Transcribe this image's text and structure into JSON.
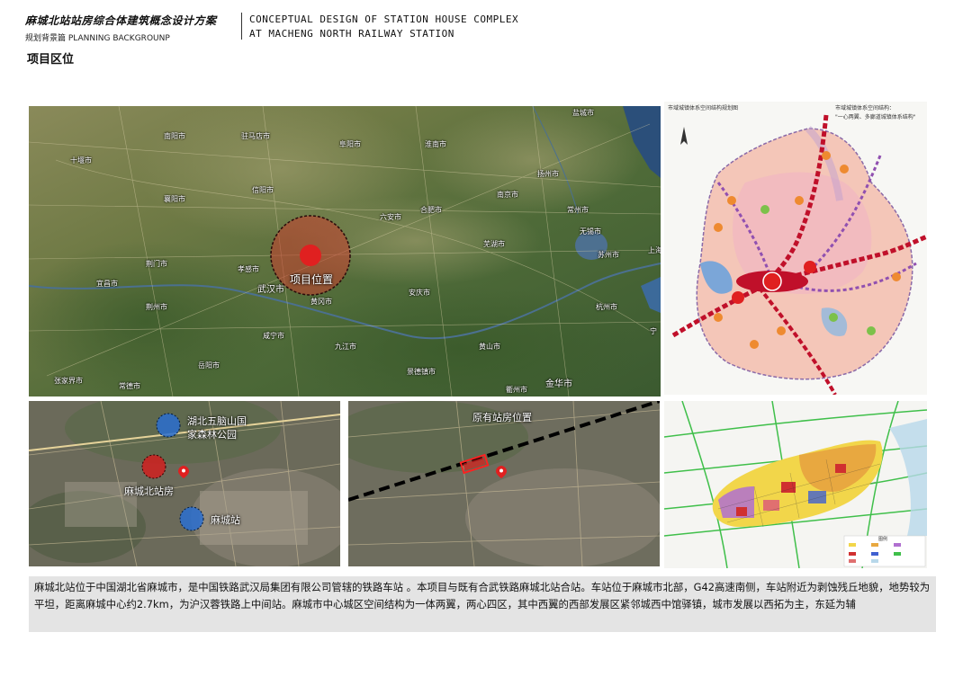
{
  "header": {
    "cn_title": "麻城北站站房综合体建筑概念设计方案",
    "subtitle": "规划背景篇  PLANNING BACKGROUNP",
    "en_title_line1": "CONCEPTUAL DESIGN OF STATION HOUSE COMPLEX",
    "en_title_line2": "AT MACHENG NORTH RAILWAY STATION"
  },
  "section_title": "项目区位",
  "main_map": {
    "project_label": "项目位置",
    "cities": [
      "盐城市",
      "南阳市",
      "驻马店市",
      "阜阳市",
      "十堰市",
      "淮南市",
      "扬州市",
      "襄阳市",
      "信阳市",
      "六安市",
      "合肥市",
      "南京市",
      "常州市",
      "无锡市",
      "上海",
      "荆门市",
      "孝感市",
      "芜湖市",
      "苏州市",
      "宜昌市",
      "荆州市",
      "武汉市",
      "黄冈市",
      "安庆市",
      "杭州市",
      "宁",
      "咸宁市",
      "九江市",
      "黄山市",
      "岳阳市",
      "常德市",
      "张家界市",
      "景德镇市",
      "金华市",
      "衢州市"
    ]
  },
  "structure_map": {
    "caption": "市域城镇体系空间结构规划图",
    "legend_title": "市域城镇体系空间结构：",
    "legend_sub": "\"一心两翼、多廊道城镇体系结构\""
  },
  "map_a": {
    "park_label_1": "湖北五脑山国",
    "park_label_2": "家森林公园",
    "north_station_label": "麻城北站房",
    "station_label": "麻城站"
  },
  "map_b": {
    "label": "原有站房位置"
  },
  "landuse_map": {
    "legend_heading": "图例"
  },
  "description": "麻城北站位于中国湖北省麻城市，是中国铁路武汉局集团有限公司管辖的铁路车站 。本项目与既有合武铁路麻城北站合站。车站位于麻城市北部，G42高速南侧，车站附近为剥蚀残丘地貌，地势较为平坦，距离麻城中心约2.7km，为沪汉蓉铁路上中间站。麻城市中心城区空间结构为一体两翼，两心四区，其中西翼的西部发展区紧邻城西中馆驿镇，城市发展以西拓为主，东延为辅",
  "colors": {
    "project_circle": "#e02020",
    "blue_circle": "#2a6fd0",
    "rail_line": "#000000"
  }
}
